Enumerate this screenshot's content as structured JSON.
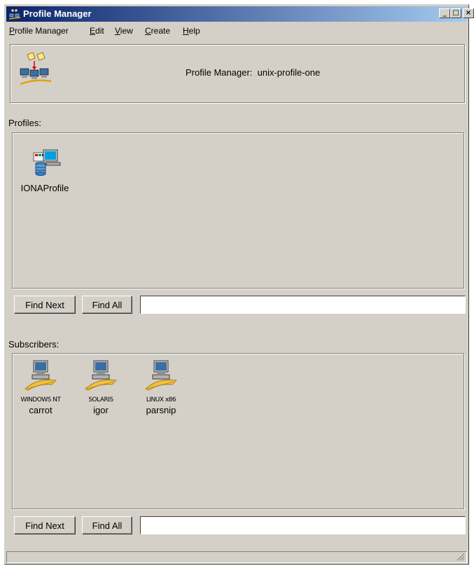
{
  "window": {
    "title": "Profile Manager",
    "controls": {
      "minimize": "_",
      "maximize": "□",
      "close": "×"
    }
  },
  "menubar": {
    "items": [
      {
        "label": "Profile Manager",
        "mnemonic": "P"
      },
      {
        "label": "Edit",
        "mnemonic": "E"
      },
      {
        "label": "View",
        "mnemonic": "V"
      },
      {
        "label": "Create",
        "mnemonic": "C"
      },
      {
        "label": "Help",
        "mnemonic": "H"
      }
    ]
  },
  "header": {
    "icon": "profile-manager-icon",
    "label": "Profile Manager:",
    "name": "unix-profile-one"
  },
  "profiles": {
    "label": "Profiles:",
    "items": [
      {
        "name": "IONAProfile",
        "icon": "database-computer-icon"
      }
    ],
    "find_next": "Find Next",
    "find_all": "Find All",
    "search_value": ""
  },
  "subscribers": {
    "label": "Subscribers:",
    "items": [
      {
        "name": "carrot",
        "os": "WINDOWS NT",
        "icon": "computer-icon"
      },
      {
        "name": "igor",
        "os": "SOLARIS",
        "icon": "computer-icon"
      },
      {
        "name": "parsnip",
        "os": "LINUX x86",
        "icon": "computer-icon"
      }
    ],
    "find_next": "Find Next",
    "find_all": "Find All",
    "search_value": ""
  },
  "status": {
    "text": ""
  },
  "colors": {
    "titlebar_start": "#0a246a",
    "titlebar_end": "#a6caf0",
    "face": "#d4d0c8"
  }
}
